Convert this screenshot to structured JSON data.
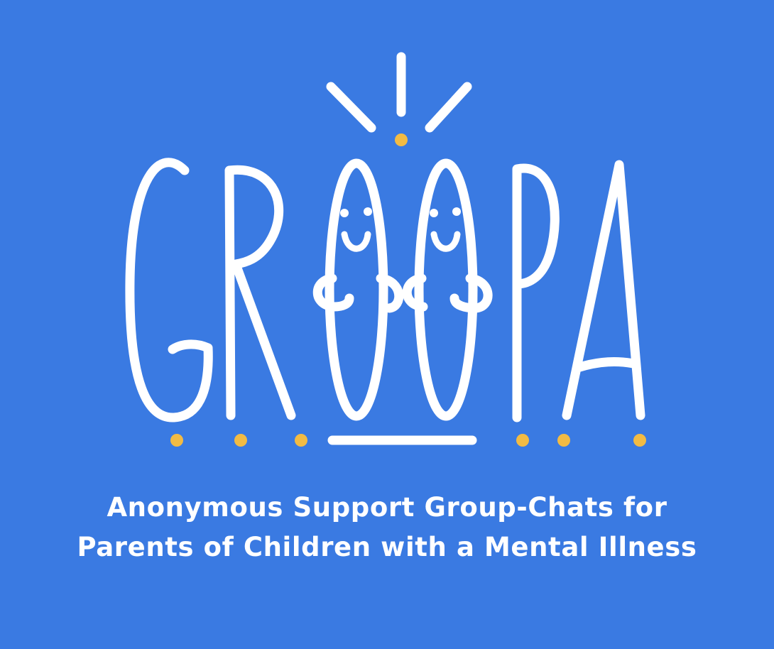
{
  "brand": {
    "name": "GROOPA"
  },
  "tagline": {
    "line1": "Anonymous Support Group-Chats for",
    "line2": "Parents of Children with a Mental Illness"
  },
  "colors": {
    "background": "#3a7ae2",
    "foreground": "#ffffff",
    "accent_dots": "#f2bb44"
  },
  "icons": [
    "sparkle-burst-icon",
    "smiley-face-icon"
  ]
}
